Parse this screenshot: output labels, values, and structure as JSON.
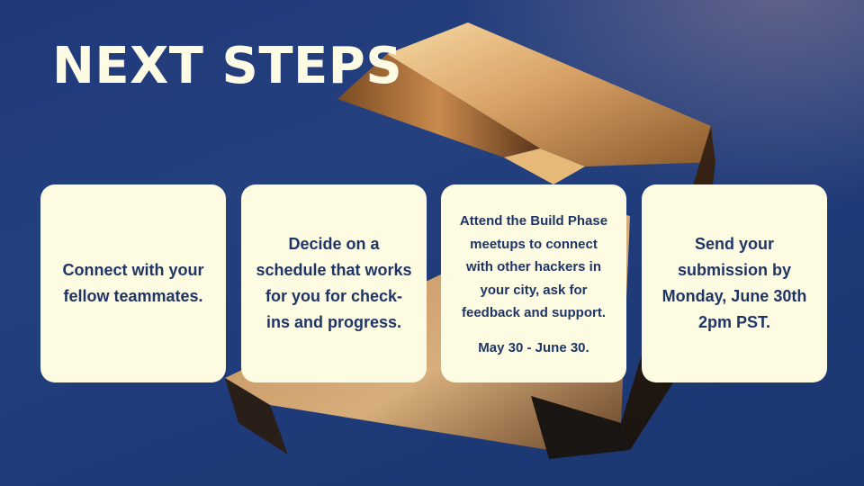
{
  "slide": {
    "title": "NEXT STEPS",
    "background_color": "#1e3a78",
    "card_color": "#fdfbe2",
    "text_color": "#1f3566",
    "decoration": "gold-3d-arrow-icon"
  },
  "cards": [
    {
      "text": "Connect with your fellow teammates."
    },
    {
      "text": "Decide on a schedule that works for you for check-ins and progress."
    },
    {
      "text": "Attend the Build Phase meetups to connect with other hackers in your city, ask for feedback and support.",
      "date": "May 30 - June 30."
    },
    {
      "text": "Send your submission by",
      "deadline": "Monday, June 30th 2pm PST."
    }
  ]
}
